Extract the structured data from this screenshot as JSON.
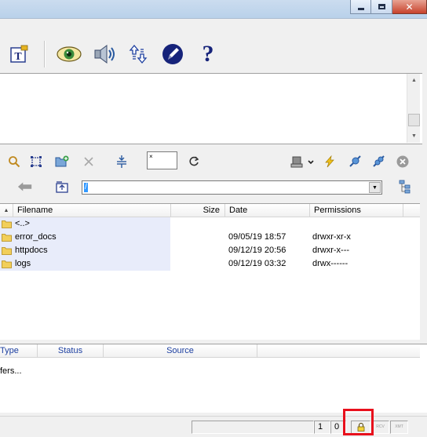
{
  "window": {
    "minimize_icon": "minimize-icon",
    "maximize_icon": "maximize-icon",
    "close_icon": "close-icon"
  },
  "toolbar": {
    "icons": [
      "edit-text-icon",
      "view-eye-icon",
      "speaker-icon",
      "transfer-arrows-icon",
      "edit-pencil-icon",
      "help-icon"
    ],
    "help_label": "?"
  },
  "remote_toolbar": {
    "icons": [
      "search-icon",
      "select-icon",
      "new-folder-icon",
      "delete-icon",
      "compare-icon",
      "refresh-icon",
      "server-icon",
      "lightning-icon",
      "connect-icon",
      "disconnect-icon",
      "stop-icon"
    ],
    "mini_input_value": "×"
  },
  "path": {
    "back_icon": "back-arrow-icon",
    "parent_icon": "parent-folder-icon",
    "tree_icon": "directory-tree-icon",
    "value": "/",
    "dropdown_icon": "chevron-down-icon"
  },
  "file_list": {
    "columns": {
      "filename": "Filename",
      "size": "Size",
      "date": "Date",
      "permissions": "Permissions"
    },
    "sort_indicator": "▲",
    "rows": [
      {
        "name": "<..>",
        "size": "",
        "date": "",
        "permissions": ""
      },
      {
        "name": "error_docs",
        "size": "",
        "date": "09/05/19  18:57",
        "permissions": "drwxr-xr-x"
      },
      {
        "name": "httpdocs",
        "size": "",
        "date": "09/12/19  20:56",
        "permissions": "drwxr-x---"
      },
      {
        "name": "logs",
        "size": "",
        "date": "09/12/19  03:32",
        "permissions": "drwx------"
      }
    ]
  },
  "queue": {
    "columns": {
      "type": "Type",
      "status": "Status",
      "source": "Source"
    },
    "message": "fers..."
  },
  "statusbar": {
    "count_1": "1",
    "count_2": "0",
    "lock_icon": "lock-icon",
    "rcv": "RCV",
    "xmt": "XMT"
  },
  "colors": {
    "link_blue": "#1c3fa0",
    "selection_row": "#e8ecfa",
    "highlight": "#e8101c"
  }
}
